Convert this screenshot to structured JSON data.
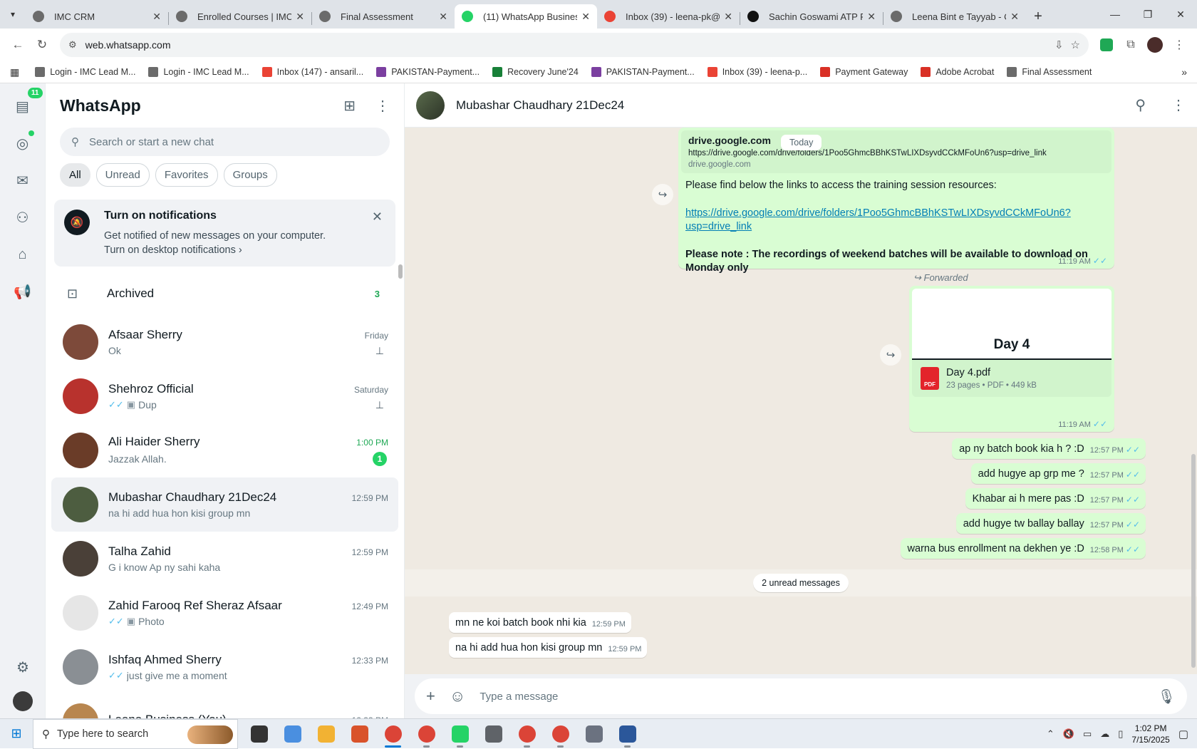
{
  "browser": {
    "tabs": [
      {
        "title": "IMC CRM",
        "color": "#6b6b6b",
        "active": false
      },
      {
        "title": "Enrolled Courses | IMC C",
        "color": "#6b6b6b",
        "active": false
      },
      {
        "title": "Final Assessment",
        "color": "#6b6b6b",
        "active": false
      },
      {
        "title": "(11) WhatsApp Business",
        "color": "#25d366",
        "active": true
      },
      {
        "title": "Inbox (39) - leena-pk@im",
        "color": "#ea4335",
        "active": false
      },
      {
        "title": "Sachin Goswami ATP PM",
        "color": "#111111",
        "active": false
      },
      {
        "title": "Leena Bint e Tayyab - Ce",
        "color": "#6b6b6b",
        "active": false
      }
    ],
    "url": "web.whatsapp.com",
    "bookmarks": [
      {
        "label": "Login - IMC Lead M...",
        "color": "#6b6b6b"
      },
      {
        "label": "Login - IMC Lead M...",
        "color": "#6b6b6b"
      },
      {
        "label": "Inbox (147) - ansaril...",
        "color": "#ea4335"
      },
      {
        "label": "PAKISTAN-Payment...",
        "color": "#7b3fa0"
      },
      {
        "label": "Recovery June'24",
        "color": "#188038"
      },
      {
        "label": "PAKISTAN-Payment...",
        "color": "#7b3fa0"
      },
      {
        "label": "Inbox (39) - leena-p...",
        "color": "#ea4335"
      },
      {
        "label": "Payment Gateway",
        "color": "#d93025"
      },
      {
        "label": "Adobe Acrobat",
        "color": "#d93025"
      },
      {
        "label": "Final Assessment",
        "color": "#6b6b6b"
      }
    ]
  },
  "rail": {
    "chats_badge": "11"
  },
  "sidebar": {
    "title": "WhatsApp",
    "search_placeholder": "Search or start a new chat",
    "filters": [
      "All",
      "Unread",
      "Favorites",
      "Groups"
    ],
    "notification": {
      "title": "Turn on notifications",
      "line1": "Get notified of new messages on your computer.",
      "line2": "Turn on desktop notifications ›"
    },
    "archived": {
      "label": "Archived",
      "count": "3"
    },
    "chats": [
      {
        "name": "Afsaar Sherry",
        "time": "Friday",
        "preview": "Ok",
        "ticks": "",
        "photo": false,
        "pinned": true,
        "unread": "",
        "avatar": "#7d4a3a"
      },
      {
        "name": "Shehroz Official",
        "time": "Saturday",
        "preview": "Dup",
        "ticks": "✓✓",
        "photo": true,
        "pinned": true,
        "unread": "",
        "avatar": "#b8322d"
      },
      {
        "name": "Ali Haider Sherry",
        "time": "1:00 PM",
        "preview": "Jazzak Allah.",
        "ticks": "",
        "photo": false,
        "pinned": false,
        "unread": "1",
        "avatar": "#6a3c28"
      },
      {
        "name": "Mubashar Chaudhary 21Dec24",
        "time": "12:59 PM",
        "preview": "na hi add hua hon kisi group mn",
        "ticks": "",
        "photo": false,
        "pinned": false,
        "unread": "",
        "avatar": "#4d5d40"
      },
      {
        "name": "Talha Zahid",
        "time": "12:59 PM",
        "preview": "G i know  Ap ny sahi kaha",
        "ticks": "",
        "photo": false,
        "pinned": false,
        "unread": "",
        "avatar": "#4a4038"
      },
      {
        "name": "Zahid Farooq Ref Sheraz Afsaar",
        "time": "12:49 PM",
        "preview": "Photo",
        "ticks": "✓✓",
        "photo": true,
        "pinned": false,
        "unread": "",
        "avatar": "#e6e6e6"
      },
      {
        "name": "Ishfaq Ahmed Sherry",
        "time": "12:33 PM",
        "preview": "just give me a moment",
        "ticks": "✓✓",
        "photo": false,
        "pinned": false,
        "unread": "",
        "avatar": "#8a8f94"
      },
      {
        "name": "Leena Business (You)",
        "time": "12:33 PM",
        "preview": "",
        "ticks": "",
        "photo": false,
        "pinned": false,
        "unread": "",
        "avatar": "#b8864f"
      }
    ]
  },
  "conversation": {
    "contact": "Mubashar Chaudhary 21Dec24",
    "today_label": "Today",
    "link_preview": {
      "domain": "drive.google.com",
      "url": "https://drive.google.com/drive/folders/1Poo5GhmcBBhKSTwLIXDsyvdCCkMFoUn6?usp=drive_link",
      "sub": "drive.google.com"
    },
    "msg1": {
      "intro": "Please find below the links to access the training session resources:",
      "link": "https://drive.google.com/drive/folders/1Poo5GhmcBBhKSTwLIXDsyvdCCkMFoUn6?usp=drive_link",
      "note": "Please note : The recordings of weekend batches will be available to download on Monday only",
      "time": "11:19 AM"
    },
    "forwarded_label": "Forwarded",
    "doc": {
      "thumb_title": "Day 4",
      "name": "Day 4.pdf",
      "info": "23 pages • PDF • 449 kB",
      "icon_label": "PDF",
      "time": "11:19 AM"
    },
    "outgoing": [
      {
        "text": "ap ny batch book kia h ? :D",
        "time": "12:57 PM"
      },
      {
        "text": "add hugye ap grp me ?",
        "time": "12:57 PM"
      },
      {
        "text": "Khabar ai h mere pas :D",
        "time": "12:57 PM"
      },
      {
        "text": "add hugye tw ballay ballay",
        "time": "12:57 PM"
      },
      {
        "text": "warna bus enrollment na dekhen ye :D",
        "time": "12:58 PM"
      }
    ],
    "unread_label": "2 unread messages",
    "incoming": [
      {
        "text": "mn ne koi batch book nhi kia",
        "time": "12:59 PM"
      },
      {
        "text": "na hi add hua hon kisi group mn",
        "time": "12:59 PM"
      }
    ],
    "composer_placeholder": "Type a message"
  },
  "taskbar": {
    "search_placeholder": "Type here to search",
    "time": "1:02 PM",
    "date": "7/15/2025",
    "apps": [
      {
        "name": "task-view",
        "color": "#333333",
        "state": ""
      },
      {
        "name": "copilot",
        "color": "#4a8fe0",
        "state": ""
      },
      {
        "name": "file-explorer",
        "color": "#f2b233",
        "state": ""
      },
      {
        "name": "app-orange",
        "color": "#d9532b",
        "state": ""
      },
      {
        "name": "chrome",
        "color": "#db4437",
        "state": "active"
      },
      {
        "name": "chrome",
        "color": "#db4437",
        "state": "open"
      },
      {
        "name": "whatsapp",
        "color": "#25d366",
        "state": "open"
      },
      {
        "name": "app-clock",
        "color": "#5f6368",
        "state": ""
      },
      {
        "name": "chrome",
        "color": "#db4437",
        "state": "open"
      },
      {
        "name": "chrome",
        "color": "#db4437",
        "state": "open"
      },
      {
        "name": "settings",
        "color": "#6b7280",
        "state": ""
      },
      {
        "name": "word",
        "color": "#2b579a",
        "state": "open"
      }
    ]
  }
}
